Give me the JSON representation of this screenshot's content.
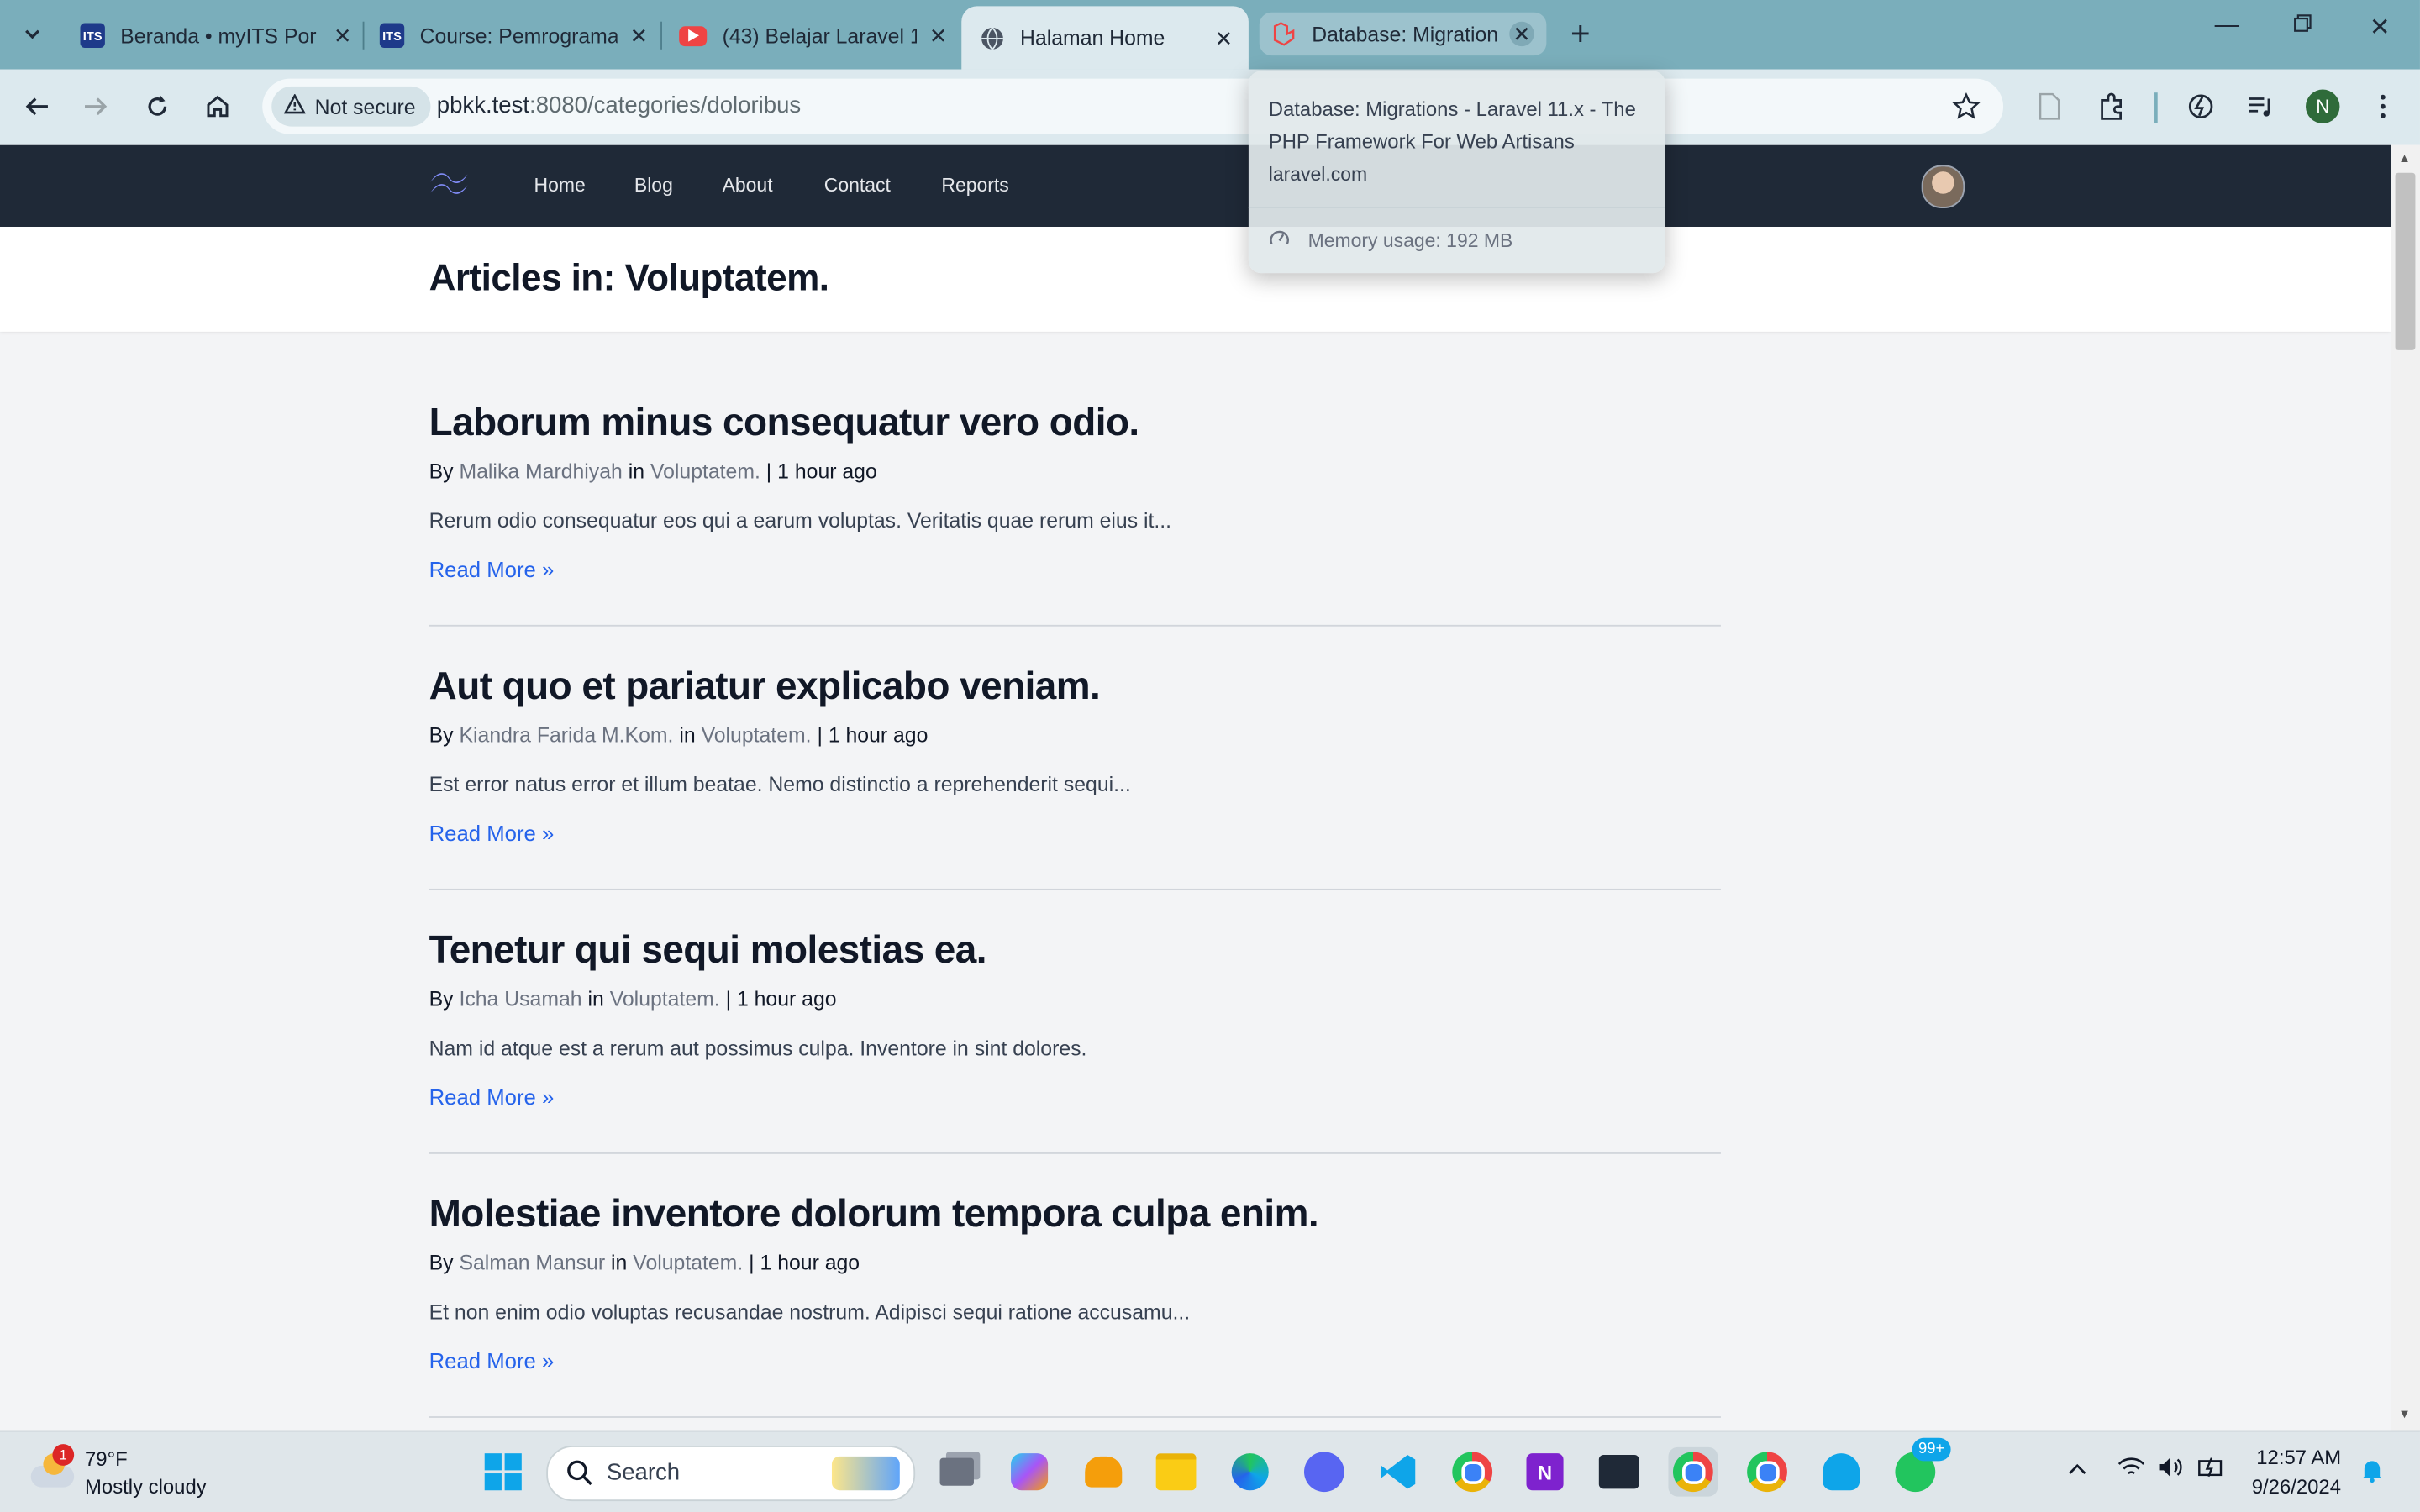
{
  "browser": {
    "tabs": [
      {
        "title": "Beranda • myITS Por",
        "favicon": "ITS",
        "active": false
      },
      {
        "title": "Course: Pemrograma",
        "favicon": "ITS",
        "active": false
      },
      {
        "title": "(43) Belajar Laravel 1",
        "favicon": "youtube",
        "active": false
      },
      {
        "title": "Halaman Home",
        "favicon": "globe",
        "active": true
      },
      {
        "title": "Database: Migration",
        "favicon": "laravel",
        "active": false
      }
    ],
    "security_label": "Not secure",
    "url_host": "pbkk.test",
    "url_rest": ":8080/categories/doloribus",
    "profile_initial": "N"
  },
  "hover_card": {
    "title": "Database: Migrations - Laravel 11.x - The PHP Framework For Web Artisans",
    "domain": "laravel.com",
    "memory": "Memory usage: 192 MB"
  },
  "site": {
    "nav": [
      "Home",
      "Blog",
      "About",
      "Contact",
      "Reports"
    ],
    "heading": "Articles in: Voluptatem.",
    "by_label": "By",
    "in_label": "in",
    "articles": [
      {
        "title": "Laborum minus consequatur vero odio.",
        "author": "Malika Mardhiyah",
        "category": "Voluptatem.",
        "time": "1 hour ago",
        "excerpt": "Rerum odio consequatur eos qui a earum voluptas. Veritatis quae rerum eius it...",
        "read_more": "Read More »"
      },
      {
        "title": "Aut quo et pariatur explicabo veniam.",
        "author": "Kiandra Farida M.Kom.",
        "category": "Voluptatem.",
        "time": "1 hour ago",
        "excerpt": "Est error natus error et illum beatae. Nemo distinctio a reprehenderit sequi...",
        "read_more": "Read More »"
      },
      {
        "title": "Tenetur qui sequi molestias ea.",
        "author": "Icha Usamah",
        "category": "Voluptatem.",
        "time": "1 hour ago",
        "excerpt": "Nam id atque est a rerum aut possimus culpa. Inventore in sint dolores.",
        "read_more": "Read More »"
      },
      {
        "title": "Molestiae inventore dolorum tempora culpa enim.",
        "author": "Salman Mansur",
        "category": "Voluptatem.",
        "time": "1 hour ago",
        "excerpt": "Et non enim odio voluptas recusandae nostrum. Adipisci sequi ratione accusamu...",
        "read_more": "Read More »"
      }
    ]
  },
  "taskbar": {
    "weather_temp": "79°F",
    "weather_desc": "Mostly cloudy",
    "weather_badge": "1",
    "search_placeholder": "Search",
    "whatsapp_badge": "99+",
    "time": "12:57 AM",
    "date": "9/26/2024"
  },
  "colors": {
    "navbar": "#1f2937",
    "link": "#2563eb",
    "tabbar": "#7aaebb",
    "toolbar": "#dce9ee"
  }
}
